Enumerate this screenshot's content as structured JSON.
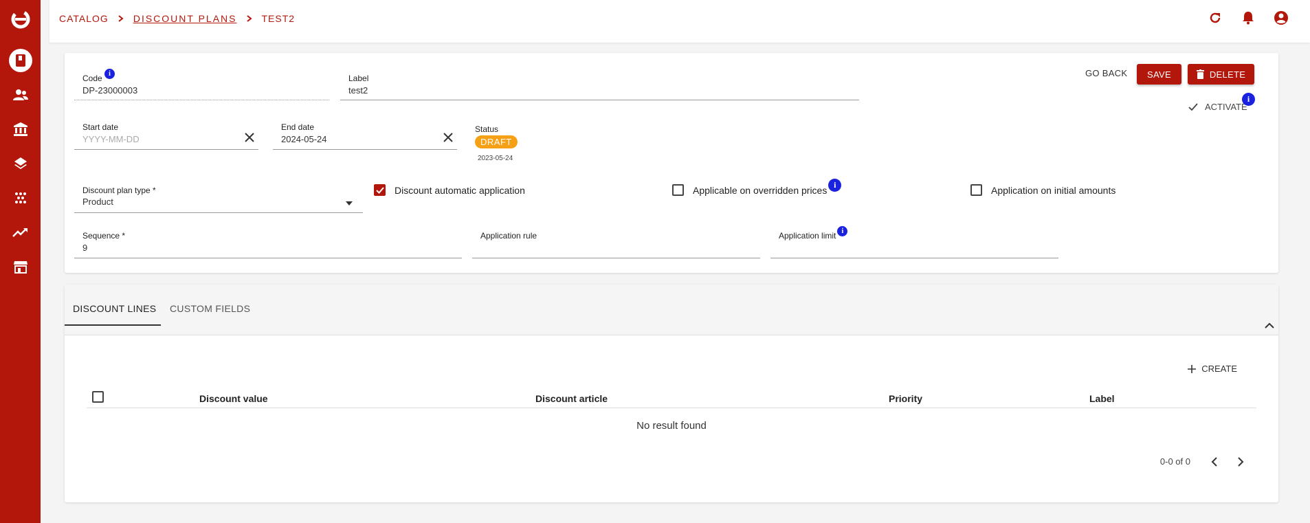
{
  "breadcrumb": {
    "catalog": "CATALOG",
    "discount_plans": "DISCOUNT PLANS",
    "current": "TEST2"
  },
  "sidebar": {
    "items": [
      {
        "icon": "book-icon",
        "active": true
      },
      {
        "icon": "users-icon"
      },
      {
        "icon": "bank-icon"
      },
      {
        "icon": "layers-icon"
      },
      {
        "icon": "dots-grid-icon"
      },
      {
        "icon": "trending-up-icon"
      },
      {
        "icon": "storefront-icon"
      }
    ]
  },
  "form": {
    "code": {
      "label": "Code",
      "value": "DP-23000003"
    },
    "label": {
      "label": "Label",
      "value": "test2"
    },
    "start_date": {
      "label": "Start date",
      "placeholder": "YYYY-MM-DD"
    },
    "end_date": {
      "label": "End date",
      "value": "2024-05-24"
    },
    "status": {
      "label": "Status",
      "value": "DRAFT",
      "date": "2023-05-24"
    },
    "discount_plan_type": {
      "label": "Discount plan type *",
      "value": "Product"
    },
    "checkboxes": {
      "automatic_application": {
        "label": "Discount automatic application",
        "checked": true
      },
      "overridden_prices": {
        "label": "Applicable on overridden prices",
        "checked": false
      },
      "initial_amounts": {
        "label": "Application on initial amounts",
        "checked": false
      }
    },
    "sequence": {
      "label": "Sequence *",
      "value": "9"
    },
    "application_rule": {
      "label": "Application rule",
      "value": ""
    },
    "application_limit": {
      "label": "Application limit",
      "value": ""
    }
  },
  "actions": {
    "go_back": "GO BACK",
    "save": "SAVE",
    "delete": "DELETE",
    "activate": "ACTIVATE"
  },
  "tabs": {
    "discount_lines": "DISCOUNT LINES",
    "custom_fields": "CUSTOM FIELDS"
  },
  "table": {
    "create": "CREATE",
    "columns": [
      "Discount value",
      "Discount article",
      "Priority",
      "Label"
    ],
    "empty": "No result found",
    "pagination": "0-0 of 0"
  },
  "colors": {
    "brand": "#b3170c",
    "draft_badge": "#f5a015",
    "info": "#1a22e0"
  }
}
